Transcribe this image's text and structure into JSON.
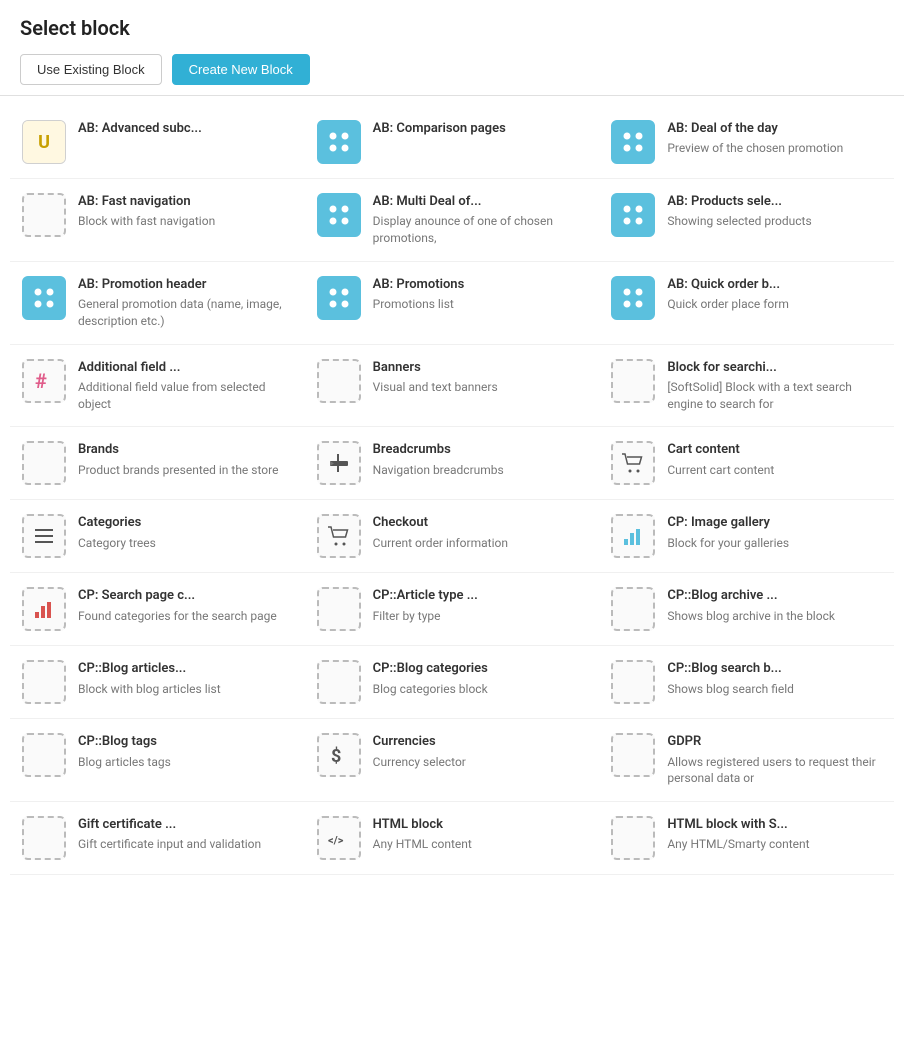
{
  "page": {
    "title": "Select block",
    "buttons": {
      "use_existing": "Use Existing Block",
      "create_new": "Create New Block"
    }
  },
  "blocks": [
    {
      "id": "ab-advanced",
      "name": "AB: Advanced subc...",
      "desc": "",
      "icon_type": "u"
    },
    {
      "id": "ab-comparison",
      "name": "AB: Comparison pages",
      "desc": "",
      "icon_type": "blue-dots"
    },
    {
      "id": "ab-deal",
      "name": "AB: Deal of the day",
      "desc": "Preview of the chosen promotion",
      "icon_type": "blue-dots"
    },
    {
      "id": "ab-fast-nav",
      "name": "AB: Fast navigation",
      "desc": "Block with fast navigation",
      "icon_type": "blank"
    },
    {
      "id": "ab-multi-deal",
      "name": "AB: Multi Deal of...",
      "desc": "Display anounce of one of chosen promotions,",
      "icon_type": "blue-dots"
    },
    {
      "id": "ab-products",
      "name": "AB: Products sele...",
      "desc": "Showing selected products",
      "icon_type": "blue-dots"
    },
    {
      "id": "ab-promo-header",
      "name": "AB: Promotion header",
      "desc": "General promotion data (name, image, description etc.)",
      "icon_type": "blue-dots"
    },
    {
      "id": "ab-promotions",
      "name": "AB: Promotions",
      "desc": "Promotions list",
      "icon_type": "blue-dots"
    },
    {
      "id": "ab-quick-order",
      "name": "AB: Quick order b...",
      "desc": "Quick order place form",
      "icon_type": "blue-dots"
    },
    {
      "id": "additional-field",
      "name": "Additional field ...",
      "desc": "Additional field value from selected object",
      "icon_type": "hashtag-pink"
    },
    {
      "id": "banners",
      "name": "Banners",
      "desc": "Visual and text banners",
      "icon_type": "dashed"
    },
    {
      "id": "block-search",
      "name": "Block for searchi...",
      "desc": "[SoftSolid] Block with a text search engine to search for",
      "icon_type": "dashed"
    },
    {
      "id": "brands",
      "name": "Brands",
      "desc": "Product brands presented in the store",
      "icon_type": "dashed"
    },
    {
      "id": "breadcrumbs",
      "name": "Breadcrumbs",
      "desc": "Navigation breadcrumbs",
      "icon_type": "signpost"
    },
    {
      "id": "cart-content",
      "name": "Cart content",
      "desc": "Current cart content",
      "icon_type": "cart"
    },
    {
      "id": "categories",
      "name": "Categories",
      "desc": "Category trees",
      "icon_type": "lines"
    },
    {
      "id": "checkout",
      "name": "Checkout",
      "desc": "Current order information",
      "icon_type": "cart2"
    },
    {
      "id": "cp-image-gallery",
      "name": "CP: Image gallery",
      "desc": "Block for your galleries",
      "icon_type": "bar-chart"
    },
    {
      "id": "cp-search-page",
      "name": "CP: Search page c...",
      "desc": "Found categories for the search page",
      "icon_type": "bar-chart-red"
    },
    {
      "id": "cp-article-type",
      "name": "CP::Article type ...",
      "desc": "Filter by type",
      "icon_type": "dashed"
    },
    {
      "id": "cp-blog-archive",
      "name": "CP::Blog archive ...",
      "desc": "Shows blog archive in the block",
      "icon_type": "dashed"
    },
    {
      "id": "cp-blog-articles",
      "name": "CP::Blog articles...",
      "desc": "Block with blog articles list",
      "icon_type": "dashed"
    },
    {
      "id": "cp-blog-categories",
      "name": "CP::Blog categories",
      "desc": "Blog categories block",
      "icon_type": "dashed"
    },
    {
      "id": "cp-blog-search",
      "name": "CP::Blog search b...",
      "desc": "Shows blog search field",
      "icon_type": "dashed"
    },
    {
      "id": "cp-blog-tags",
      "name": "CP::Blog tags",
      "desc": "Blog articles tags",
      "icon_type": "dashed"
    },
    {
      "id": "currencies",
      "name": "Currencies",
      "desc": "Currency selector",
      "icon_type": "dollar"
    },
    {
      "id": "gdpr",
      "name": "GDPR",
      "desc": "Allows registered users to request their personal data or",
      "icon_type": "dashed"
    },
    {
      "id": "gift-certificate",
      "name": "Gift certificate ...",
      "desc": "Gift certificate input and validation",
      "icon_type": "dashed"
    },
    {
      "id": "html-block",
      "name": "HTML block",
      "desc": "Any HTML content",
      "icon_type": "html"
    },
    {
      "id": "html-block-smarty",
      "name": "HTML block with S...",
      "desc": "Any HTML/Smarty content",
      "icon_type": "dashed"
    }
  ]
}
